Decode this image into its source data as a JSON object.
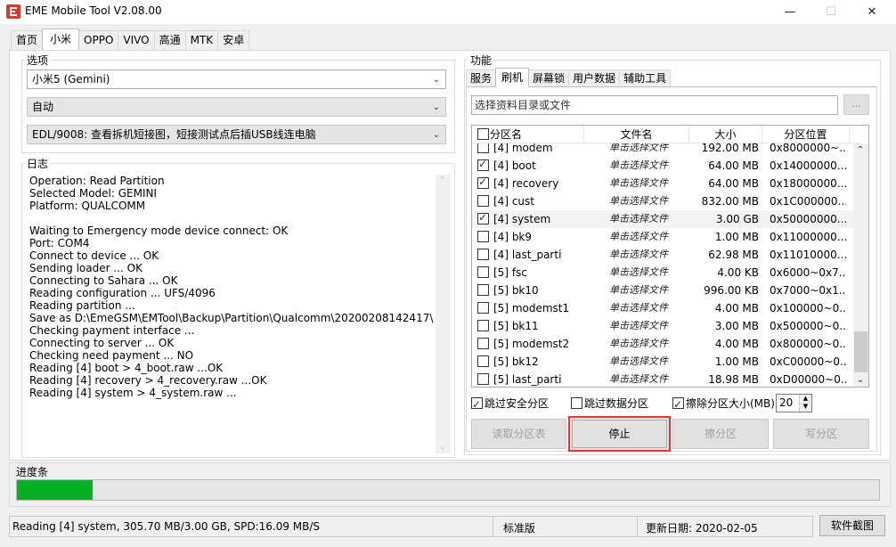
{
  "window": {
    "title": "EME Mobile Tool V2.08.00",
    "minimize": "—",
    "maximize": "☐",
    "close": "✕"
  },
  "top_tabs": [
    "首页",
    "小米",
    "OPPO",
    "VIVO",
    "高通",
    "MTK",
    "安卓"
  ],
  "active_top_tab": "小米",
  "options": {
    "label": "选项",
    "model": "小米5 (Gemini)",
    "mode": "自动",
    "edl": "EDL/9008: 查看拆机短接图，短接测试点后插USB线连电脑"
  },
  "log": {
    "label": "日志",
    "lines": [
      "Operation: Read Partition",
      "Selected Model:  GEMINI",
      "Platform:  QUALCOMM",
      "",
      "Waiting to Emergency mode device connect: OK",
      "Port: COM4",
      "Connect to device ... OK",
      "Sending loader ... OK",
      "Connecting to Sahara ... OK",
      "Reading configuration ... UFS/4096",
      "Reading partition ...",
      "Save as D:\\EmeGSM\\EMTool\\Backup\\Partition\\Qualcomm\\20200208142417\\",
      "Checking payment interface ...",
      "Connecting to server ... OK",
      "Checking need payment ... NO",
      "Reading [4] boot > 4_boot.raw ...OK",
      "Reading [4] recovery > 4_recovery.raw ...OK",
      "Reading [4] system > 4_system.raw ..."
    ]
  },
  "function": {
    "label": "功能",
    "tabs": [
      "服务",
      "刷机",
      "屏幕锁",
      "用户数据",
      "辅助工具"
    ],
    "active_tab": "刷机",
    "path_placeholder": "选择资料目录或文件",
    "browse_label": "...",
    "columns": [
      "分区名",
      "文件名",
      "大小",
      "分区位置"
    ],
    "rows": [
      {
        "checked": false,
        "name": "[4] modem",
        "file": "单击选择文件",
        "size": "192.00 MB",
        "loc": "0x8000000~..."
      },
      {
        "checked": true,
        "name": "[4] boot",
        "file": "单击选择文件",
        "size": "64.00 MB",
        "loc": "0x14000000..."
      },
      {
        "checked": true,
        "name": "[4] recovery",
        "file": "单击选择文件",
        "size": "64.00 MB",
        "loc": "0x18000000..."
      },
      {
        "checked": false,
        "name": "[4] cust",
        "file": "单击选择文件",
        "size": "832.00 MB",
        "loc": "0x1C000000..."
      },
      {
        "checked": true,
        "name": "[4] system",
        "file": "单击选择文件",
        "size": "3.00 GB",
        "loc": "0x50000000...",
        "selected": true
      },
      {
        "checked": false,
        "name": "[4] bk9",
        "file": "单击选择文件",
        "size": "1.00 MB",
        "loc": "0x11000000..."
      },
      {
        "checked": false,
        "name": "[4] last_parti",
        "file": "单击选择文件",
        "size": "62.98 MB",
        "loc": "0x11010000..."
      },
      {
        "checked": false,
        "name": "[5] fsc",
        "file": "单击选择文件",
        "size": "4.00 KB",
        "loc": "0x6000~0x7..."
      },
      {
        "checked": false,
        "name": "[5] bk10",
        "file": "单击选择文件",
        "size": "996.00 KB",
        "loc": "0x7000~0x1..."
      },
      {
        "checked": false,
        "name": "[5] modemst1",
        "file": "单击选择文件",
        "size": "4.00 MB",
        "loc": "0x100000~0..."
      },
      {
        "checked": false,
        "name": "[5] bk11",
        "file": "单击选择文件",
        "size": "3.00 MB",
        "loc": "0x500000~0..."
      },
      {
        "checked": false,
        "name": "[5] modemst2",
        "file": "单击选择文件",
        "size": "4.00 MB",
        "loc": "0x800000~0..."
      },
      {
        "checked": false,
        "name": "[5] bk12",
        "file": "单击选择文件",
        "size": "1.00 MB",
        "loc": "0xC00000~0..."
      },
      {
        "checked": false,
        "name": "[5] last_parti",
        "file": "单击选择文件",
        "size": "18.98 MB",
        "loc": "0xD00000~0..."
      }
    ],
    "opt_skip_safe": "跳过安全分区",
    "opt_skip_data": "跳过数据分区",
    "opt_erase_size": "擦除分区大小(MB)",
    "erase_value": "20",
    "buttons": {
      "read_table": "读取分区表",
      "stop": "停止",
      "erase": "擦分区",
      "write": "写分区"
    }
  },
  "progress": {
    "label": "进度条",
    "fraction": 0.088
  },
  "status": {
    "text": "Reading [4] system, 305.70 MB/3.00 GB, SPD:16.09 MB/S",
    "edition": "标准版",
    "update_date": "更新日期:  2020-02-05",
    "screenshot_button": "软件截图"
  }
}
